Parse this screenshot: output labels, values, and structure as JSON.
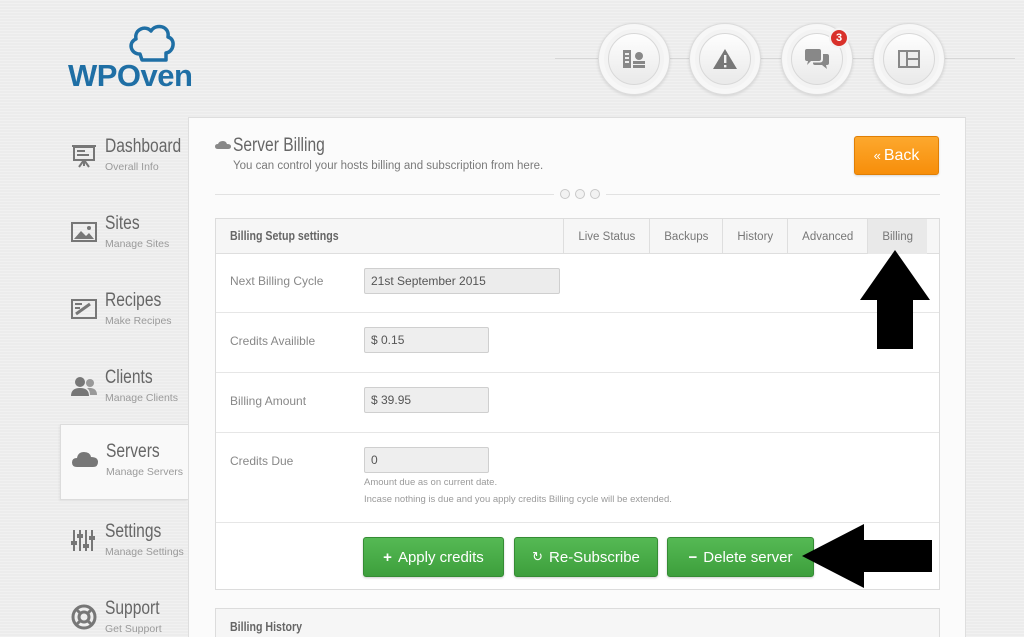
{
  "brand": {
    "name": "WPOven",
    "color": "#1f6fa5"
  },
  "top_icons": [
    {
      "name": "billing-icon"
    },
    {
      "name": "warning-icon"
    },
    {
      "name": "chat-icon",
      "badge": "3"
    },
    {
      "name": "layout-icon"
    }
  ],
  "sidebar": {
    "items": [
      {
        "title": "Dashboard",
        "subtitle": "Overall Info",
        "icon": "presentation-icon"
      },
      {
        "title": "Sites",
        "subtitle": "Manage Sites",
        "icon": "image-icon"
      },
      {
        "title": "Recipes",
        "subtitle": "Make Recipes",
        "icon": "recipe-icon"
      },
      {
        "title": "Clients",
        "subtitle": "Manage Clients",
        "icon": "users-icon"
      },
      {
        "title": "Servers",
        "subtitle": "Manage Servers",
        "icon": "cloud-icon",
        "active": true
      },
      {
        "title": "Settings",
        "subtitle": "Manage Settings",
        "icon": "sliders-icon"
      },
      {
        "title": "Support",
        "subtitle": "Get Support",
        "icon": "lifebuoy-icon"
      }
    ]
  },
  "page": {
    "title": "Server Billing",
    "subtitle": "You can control your hosts billing and subscription from here.",
    "back_label": "Back"
  },
  "billing": {
    "title": "Billing Setup settings",
    "tabs": [
      "Live Status",
      "Backups",
      "History",
      "Advanced",
      "Billing"
    ],
    "active_tab": "Billing",
    "fields": [
      {
        "label": "Next Billing Cycle",
        "value": "21st September 2015"
      },
      {
        "label": "Credits Availible",
        "value": "$ 0.15"
      },
      {
        "label": "Billing Amount",
        "value": "$ 39.95"
      },
      {
        "label": "Credits Due",
        "value": "0"
      }
    ],
    "help_1": "Amount due as on current date.",
    "help_2": "Incase nothing is due and you apply credits Billing cycle will be extended.",
    "buttons": {
      "apply": "Apply credits",
      "resubscribe": "Re-Subscribe",
      "delete": "Delete server"
    }
  },
  "history": {
    "title": "Billing History"
  },
  "colors": {
    "accent_orange": "#f99b1a",
    "accent_green": "#4cae4b"
  }
}
